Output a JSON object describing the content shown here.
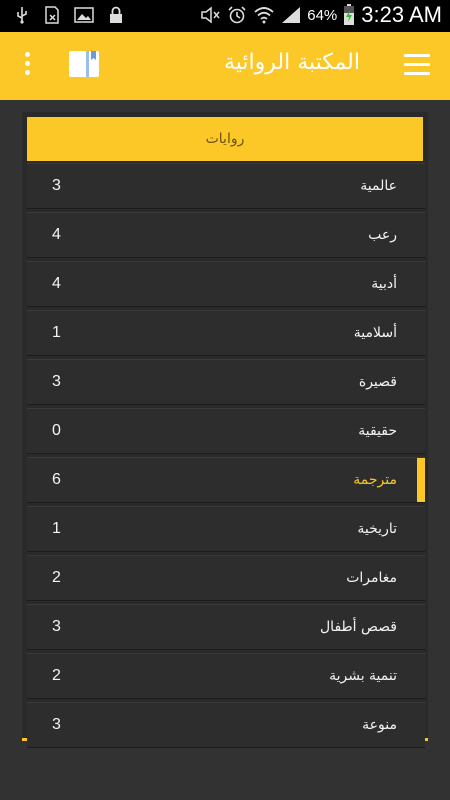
{
  "status_bar": {
    "battery_percent": "64%",
    "time": "3:23 AM",
    "icons": [
      "usb-icon",
      "sim-icon",
      "image-icon",
      "lock-icon",
      "mute-icon",
      "alarm-icon",
      "wifi-icon",
      "signal-icon",
      "battery-charging-icon"
    ]
  },
  "app_bar": {
    "title": "المكتبة الروائية",
    "icons": [
      "menu-icon",
      "book-icon",
      "overflow-menu-icon"
    ],
    "accent_color": "#fcc827"
  },
  "panel": {
    "header": "روايات",
    "rows": [
      {
        "label": "عالمية",
        "count": "3"
      },
      {
        "label": "رعب",
        "count": "4"
      },
      {
        "label": "أدبية",
        "count": "4"
      },
      {
        "label": "أسلامية",
        "count": "1"
      },
      {
        "label": "قصيرة",
        "count": "3"
      },
      {
        "label": "حقيقية",
        "count": "0"
      },
      {
        "label": "مترجمة",
        "count": "6"
      },
      {
        "label": "تاريخية",
        "count": "1"
      },
      {
        "label": "مغامرات",
        "count": "2"
      },
      {
        "label": "قصص أطفال",
        "count": "3"
      },
      {
        "label": "تنمية بشرية",
        "count": "2"
      },
      {
        "label": "منوعة",
        "count": "3"
      }
    ],
    "selected_label": "مترجمة"
  }
}
